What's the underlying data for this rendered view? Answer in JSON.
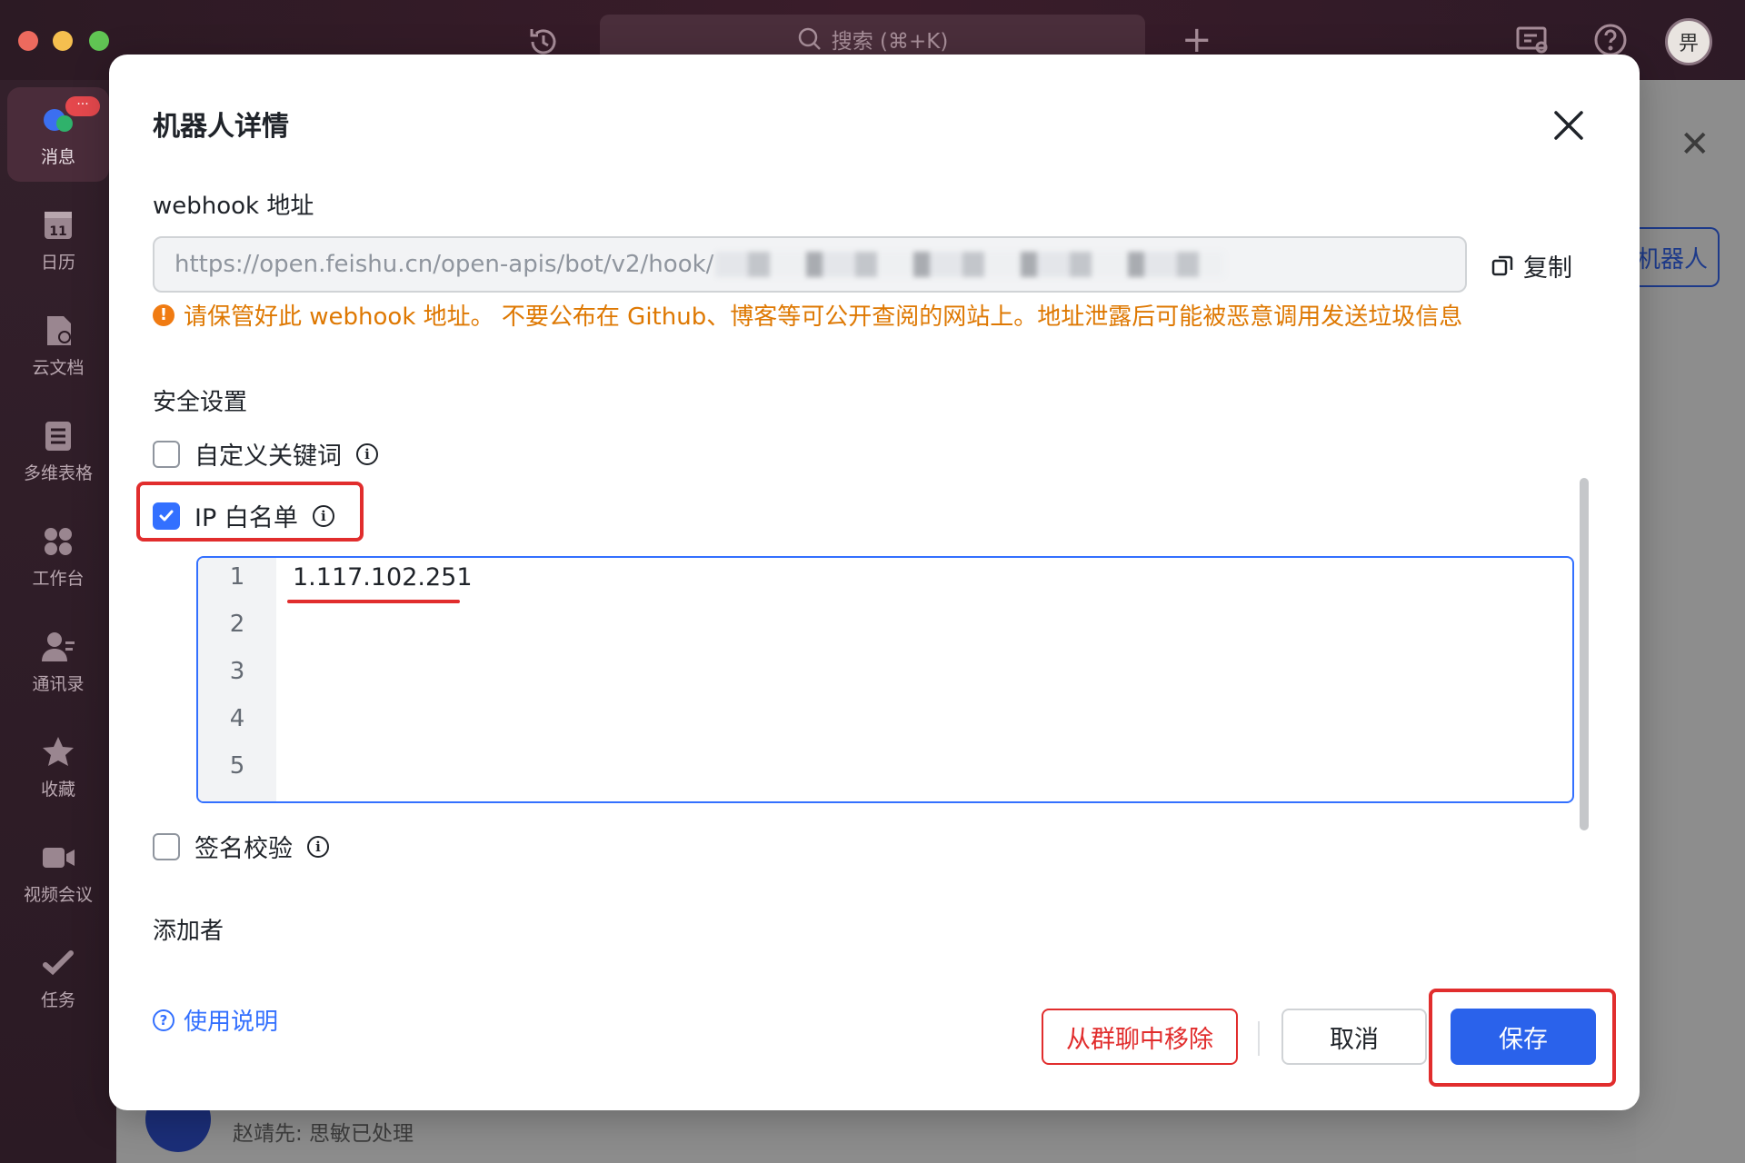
{
  "topbar": {
    "search_placeholder": "搜索 (⌘+K)",
    "avatar_text": "畀"
  },
  "sidebar": {
    "badge": "···",
    "items": [
      {
        "label": "消息",
        "icon": "chat-icon",
        "active": true
      },
      {
        "label": "日历",
        "icon": "calendar-icon",
        "day": "11"
      },
      {
        "label": "云文档",
        "icon": "doc-icon"
      },
      {
        "label": "多维表格",
        "icon": "table-icon"
      },
      {
        "label": "工作台",
        "icon": "apps-icon"
      },
      {
        "label": "通讯录",
        "icon": "contacts-icon"
      },
      {
        "label": "收藏",
        "icon": "star-icon"
      },
      {
        "label": "视频会议",
        "icon": "video-icon"
      },
      {
        "label": "任务",
        "icon": "task-icon"
      }
    ]
  },
  "background": {
    "robot_button": "机器人",
    "chat_preview": "赵靖先: 思敏已处理"
  },
  "modal": {
    "title": "机器人详情",
    "webhook": {
      "label": "webhook 地址",
      "url_visible": "https://open.feishu.cn/open-apis/bot/v2/hook/",
      "copy_label": "复制",
      "warning": "请保管好此 webhook 地址。 不要公布在 Github、博客等可公开查阅的网站上。地址泄露后可能被恶意调用发送垃圾信息"
    },
    "security": {
      "label": "安全设置",
      "options": [
        {
          "label": "自定义关键词",
          "checked": false
        },
        {
          "label": "IP 白名单",
          "checked": true
        },
        {
          "label": "签名校验",
          "checked": false
        }
      ],
      "ip_lines": [
        {
          "no": "1",
          "text": "1.117.102.251"
        },
        {
          "no": "2",
          "text": ""
        },
        {
          "no": "3",
          "text": ""
        },
        {
          "no": "4",
          "text": ""
        },
        {
          "no": "5",
          "text": ""
        }
      ]
    },
    "adder_label": "添加者",
    "help_link": "使用说明",
    "buttons": {
      "remove": "从群聊中移除",
      "cancel": "取消",
      "save": "保存"
    }
  },
  "colors": {
    "primary": "#3370ff",
    "save_button": "#2a62eb",
    "warning": "#de7802",
    "annotation": "#e12d2d"
  }
}
